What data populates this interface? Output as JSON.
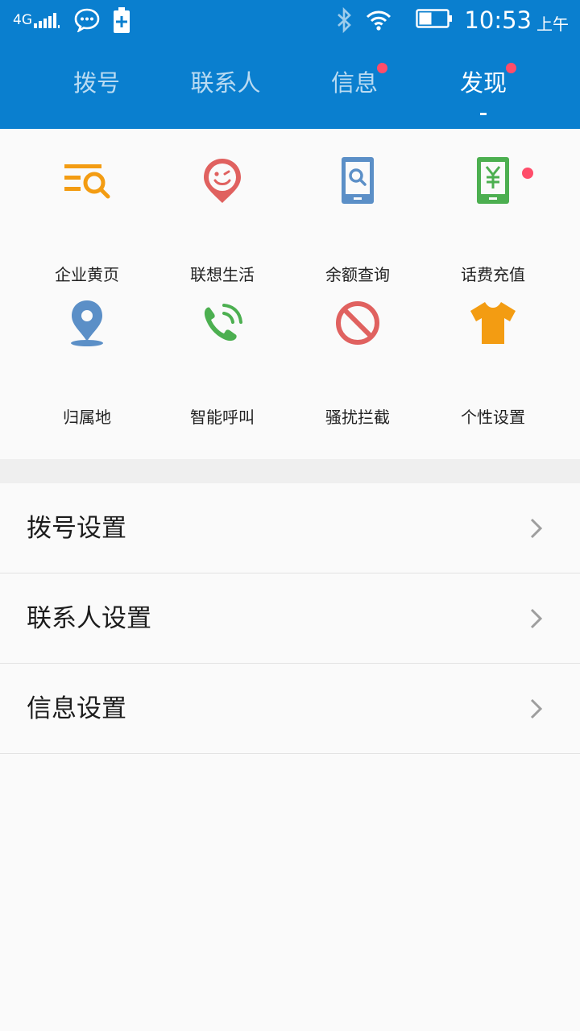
{
  "status_bar": {
    "network": "4G",
    "time": "10:53",
    "ampm": "上午",
    "icons": [
      "signal-icon",
      "message-bubble-icon",
      "battery-charging-icon",
      "bluetooth-icon",
      "wifi-icon",
      "battery-icon"
    ]
  },
  "tabs": [
    {
      "label": "拨号",
      "badge": false,
      "active": false
    },
    {
      "label": "联系人",
      "badge": false,
      "active": false
    },
    {
      "label": "信息",
      "badge": true,
      "active": false
    },
    {
      "label": "发现",
      "badge": true,
      "active": true
    }
  ],
  "features": [
    {
      "label": "企业黄页",
      "icon": "yellow-pages-icon",
      "color": "#f39c12",
      "badge": false
    },
    {
      "label": "联想生活",
      "icon": "smile-pin-icon",
      "color": "#e0615f",
      "badge": false
    },
    {
      "label": "余额查询",
      "icon": "phone-search-icon",
      "color": "#5b8fc7",
      "badge": false
    },
    {
      "label": "话费充值",
      "icon": "phone-yuan-icon",
      "color": "#4caf50",
      "badge": true
    },
    {
      "label": "归属地",
      "icon": "location-pin-icon",
      "color": "#5b8fc7",
      "badge": false
    },
    {
      "label": "智能呼叫",
      "icon": "smart-call-icon",
      "color": "#4caf50",
      "badge": false
    },
    {
      "label": "骚扰拦截",
      "icon": "block-icon",
      "color": "#e0615f",
      "badge": false
    },
    {
      "label": "个性设置",
      "icon": "tshirt-icon",
      "color": "#f39c12",
      "badge": false
    }
  ],
  "settings": [
    {
      "label": "拨号设置"
    },
    {
      "label": "联系人设置"
    },
    {
      "label": "信息设置"
    }
  ],
  "colors": {
    "header": "#0a7fcf",
    "badge": "#ff4d6a"
  }
}
